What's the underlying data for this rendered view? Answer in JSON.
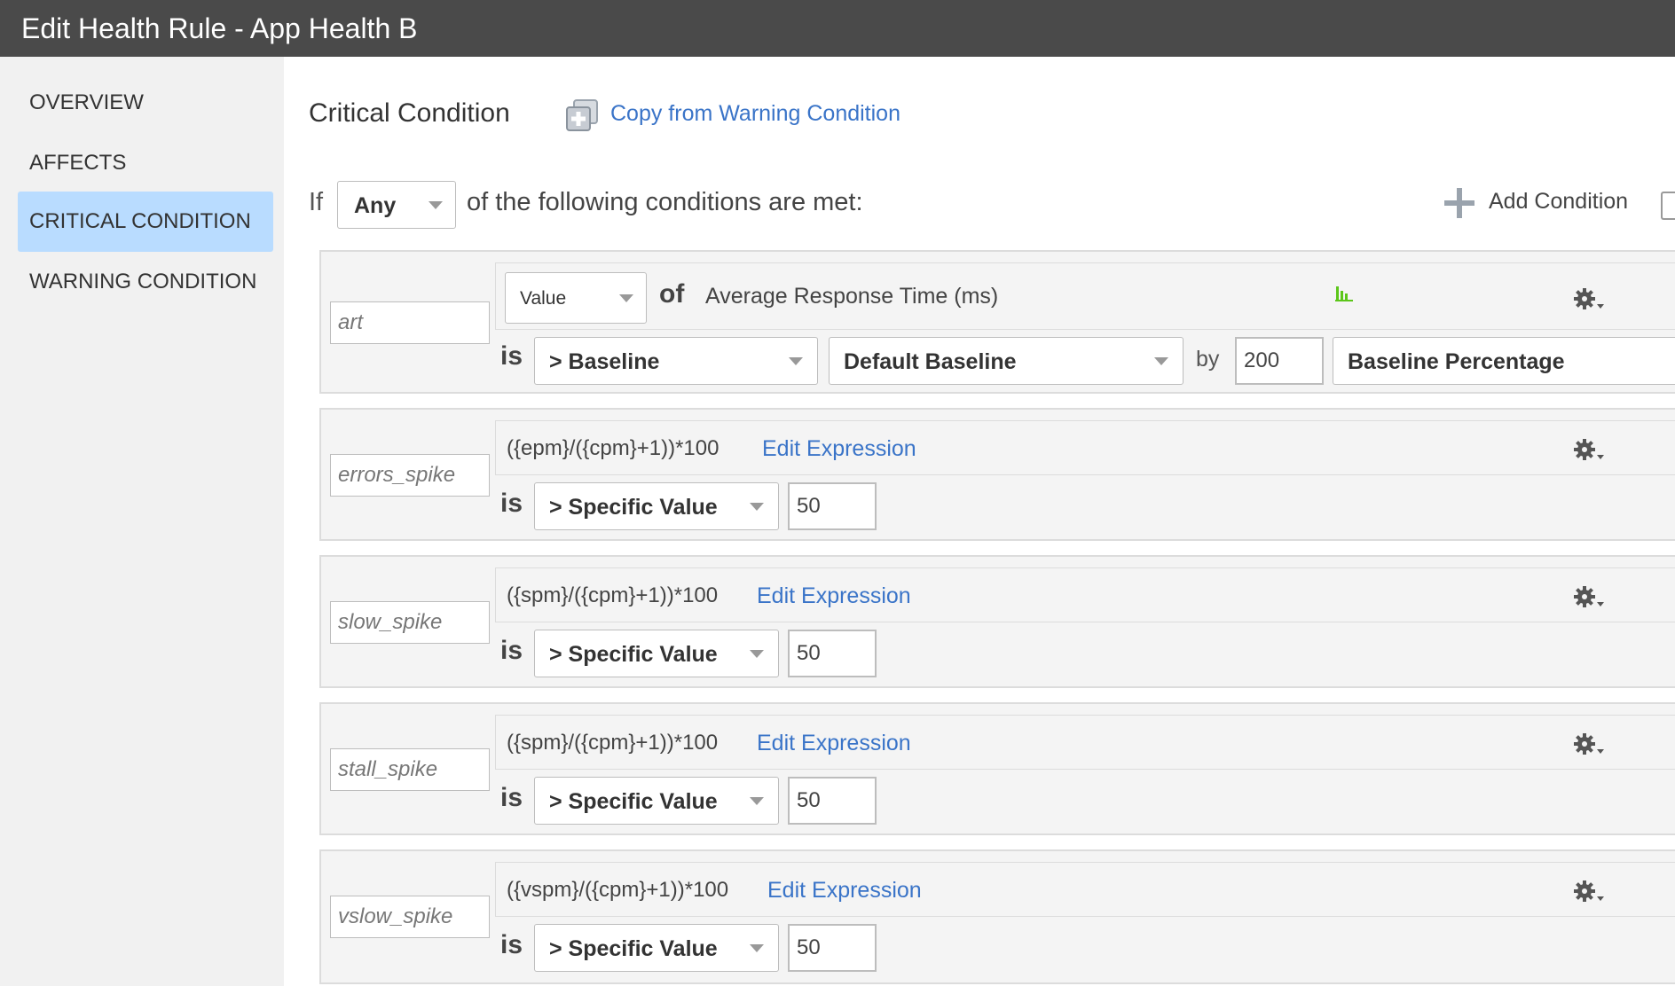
{
  "window": {
    "title": "Edit Health Rule - App Health B"
  },
  "sidebar": {
    "items": [
      {
        "label": "OVERVIEW",
        "active": false
      },
      {
        "label": "AFFECTS",
        "active": false
      },
      {
        "label": "CRITICAL CONDITION",
        "active": true
      },
      {
        "label": "WARNING CONDITION",
        "active": false
      }
    ]
  },
  "header": {
    "title": "Critical Condition",
    "copy_link": "Copy from Warning Condition"
  },
  "condition_bar": {
    "if_label": "If",
    "match_select": "Any",
    "following_text": "of the following conditions are met:",
    "add_condition": "Add Condition"
  },
  "conditions": [
    {
      "name": "art",
      "value_select": "Value",
      "of_label": "of",
      "metric": "Average Response Time (ms)",
      "is_label": "is",
      "operator": "> Baseline",
      "baseline": "Default Baseline",
      "by_label": "by",
      "amount": "200",
      "unit": "Baseline Percentage"
    },
    {
      "name": "errors_spike",
      "expression": "({epm}/({cpm}+1))*100",
      "edit_label": "Edit Expression",
      "is_label": "is",
      "operator": "> Specific Value",
      "value": "50"
    },
    {
      "name": "slow_spike",
      "expression": "({spm}/({cpm}+1))*100",
      "edit_label": "Edit Expression",
      "is_label": "is",
      "operator": "> Specific Value",
      "value": "50"
    },
    {
      "name": "stall_spike",
      "expression": "({spm}/({cpm}+1))*100",
      "edit_label": "Edit Expression",
      "is_label": "is",
      "operator": "> Specific Value",
      "value": "50"
    },
    {
      "name": "vslow_spike",
      "expression": "({vspm}/({cpm}+1))*100",
      "edit_label": "Edit Expression",
      "is_label": "is",
      "operator": "> Specific Value",
      "value": "50"
    }
  ],
  "colors": {
    "titlebar": "#4a4a4a",
    "sidebar_active": "#b9dcff",
    "link": "#3a74c8",
    "metric_icon": "#5cc61a"
  },
  "icons": [
    "copy-plus-icon",
    "plus-icon",
    "bar-chart-icon",
    "gear-icon",
    "chevron-down-icon"
  ]
}
